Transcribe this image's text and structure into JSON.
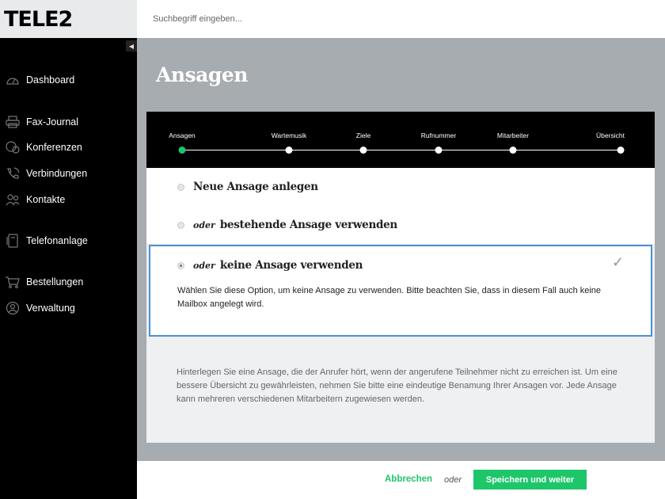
{
  "brand": {
    "logo": "TELE2",
    "accent": "#1ec66a",
    "selection_border": "#4a8fd8"
  },
  "search": {
    "placeholder": "Suchbegriff eingeben..."
  },
  "sidebar": {
    "collapse_icon": "triangle-left-icon",
    "items": [
      {
        "label": "Dashboard",
        "icon": "speedometer-icon"
      },
      {
        "label": "Fax-Journal",
        "icon": "printer-icon"
      },
      {
        "label": "Konferenzen",
        "icon": "conference-icon"
      },
      {
        "label": "Verbindungen",
        "icon": "phone-signal-icon"
      },
      {
        "label": "Kontakte",
        "icon": "contacts-icon"
      },
      {
        "label": "Telefonanlage",
        "icon": "phone-system-icon"
      },
      {
        "label": "Bestellungen",
        "icon": "cart-icon"
      },
      {
        "label": "Verwaltung",
        "icon": "user-circle-icon"
      }
    ]
  },
  "main": {
    "title": "Ansagen",
    "steps": [
      {
        "label": "Ansagen",
        "active": true
      },
      {
        "label": "Wartemusik",
        "active": false
      },
      {
        "label": "Ziele",
        "active": false
      },
      {
        "label": "Rufnummer",
        "active": false
      },
      {
        "label": "Mitarbeiter",
        "active": false
      },
      {
        "label": "Übersicht",
        "active": false
      }
    ],
    "options": [
      {
        "prefix": "",
        "label": "Neue Ansage anlegen",
        "selected": false
      },
      {
        "prefix": "oder",
        "label": "bestehende Ansage verwenden",
        "selected": false
      },
      {
        "prefix": "oder",
        "label": "keine Ansage verwenden",
        "selected": true,
        "description": "Wählen Sie diese Option, um keine Ansage zu verwenden. Bitte beachten Sie, dass in diesem Fall auch keine Mailbox angelegt wird."
      }
    ],
    "info": "Hinterlegen Sie eine Ansage, die der Anrufer hört, wenn der angerufene Teilnehmer nicht zu erreichen ist. Um eine bessere Übersicht zu gewährleisten, nehmen Sie bitte eine eindeutige Benamung Ihrer Ansagen vor. Jede Ansage kann mehreren verschiedenen Mitarbeitern zugewiesen werden."
  },
  "footer": {
    "cancel_label": "Abbrechen",
    "or_label": "oder",
    "save_label": "Speichern und weiter"
  }
}
